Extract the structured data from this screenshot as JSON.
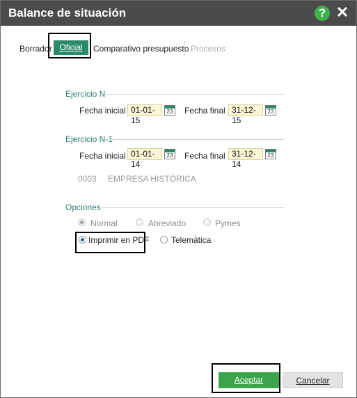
{
  "window": {
    "title": "Balance de situación",
    "help_icon": "question-icon",
    "close_icon": "close-icon",
    "help_symbol": "?",
    "close_symbol": "✕",
    "accent_color": "#2a8a6a",
    "titlebar_color": "#4b4b4b"
  },
  "tabs": {
    "borrador": "Borrador",
    "oficial": "Oficial",
    "comparativo": "Comparativo presupuesto",
    "procesos": "Procesos",
    "active": "Oficial"
  },
  "ejercicio_n": {
    "title": "Ejercicio N",
    "fecha_inicial_label": "Fecha inicial",
    "fecha_inicial_value": "01-01-15",
    "fecha_final_label": "Fecha final",
    "fecha_final_value": "31-12-15"
  },
  "ejercicio_n1": {
    "title": "Ejercicio N-1",
    "fecha_inicial_label": "Fecha inicial",
    "fecha_inicial_value": "01-01-14",
    "fecha_final_label": "Fecha final",
    "fecha_final_value": "31-12-14"
  },
  "calendar_icon_day": "23",
  "company": {
    "code": "0003",
    "name": "EMPRESA HISTÓRICA"
  },
  "opciones": {
    "title": "Opciones",
    "normal": "Normal",
    "abreviado": "Abreviado",
    "pymes": "Pymes",
    "imprimir_pdf": "Imprimir en PDF",
    "telematica": "Telemática",
    "selected_format": "Normal",
    "selected_output": "Imprimir en PDF"
  },
  "buttons": {
    "aceptar": "Aceptar",
    "cancelar": "Cancelar"
  }
}
